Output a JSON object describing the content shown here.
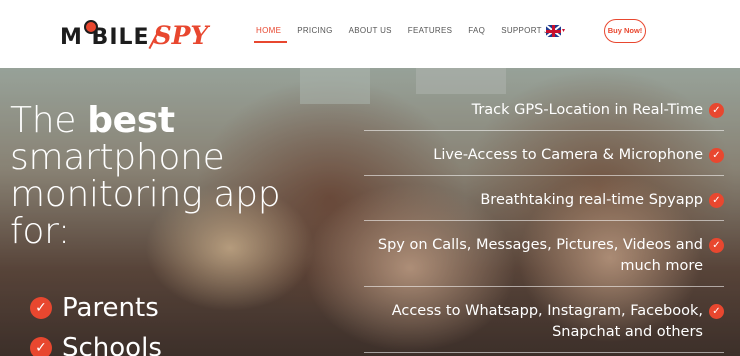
{
  "brand": {
    "logo_word": "M BILE",
    "logo_accent": "SPY"
  },
  "nav": {
    "items": [
      "HOME",
      "PRICING",
      "ABOUT US",
      "FEATURES",
      "FAQ",
      "SUPPORT"
    ],
    "active": "HOME",
    "support_caret": "⌄",
    "language_icon": "uk-flag-icon",
    "buy_label": "Buy Now!"
  },
  "hero": {
    "headline_pre": "The ",
    "headline_bold": "best",
    "headline_line2": "smartphone",
    "headline_line3": "monitoring app",
    "headline_line4": "for:",
    "audience": [
      "Parents",
      "Schools"
    ],
    "features": [
      "Track GPS-Location in Real-Time",
      "Live-Access to Camera & Microphone",
      "Breathtaking real-time Spyapp",
      "Spy on Calls, Messages, Pictures, Videos and much more",
      "Access to Whatsapp, Instagram, Facebook, Snapchat and others"
    ]
  },
  "colors": {
    "accent": "#e8472f",
    "text_dark": "#1d1d1d",
    "nav_text": "#555555"
  }
}
